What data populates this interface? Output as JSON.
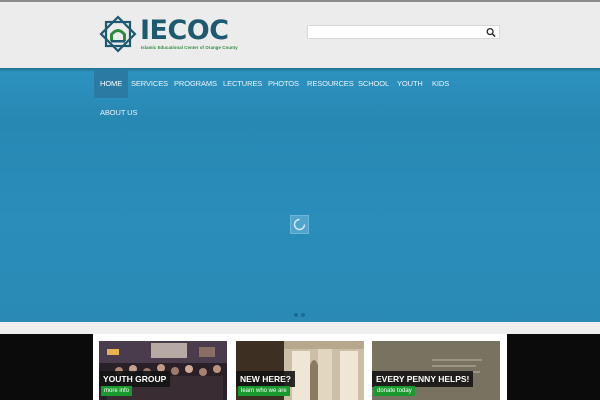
{
  "brand": {
    "name": "IECOC",
    "tagline": "Islamic Educational Center of Orange County",
    "colors": {
      "primary": "#1d5a6f",
      "accent": "#2c8a3b",
      "hero": "#2a8ab5"
    }
  },
  "search": {
    "placeholder": "",
    "button_icon": "magnifier-icon"
  },
  "nav": {
    "items": [
      {
        "label": "HOME",
        "active": true
      },
      {
        "label": "SERVICES"
      },
      {
        "label": "PROGRAMS"
      },
      {
        "label": "LECTURES"
      },
      {
        "label": "PHOTOS"
      },
      {
        "label": "RESOURCES"
      },
      {
        "label": "SCHOOL"
      },
      {
        "label": "YOUTH"
      },
      {
        "label": "KIDS"
      },
      {
        "label": "ABOUT US"
      }
    ]
  },
  "slider": {
    "loading_icon": "spinner-icon",
    "slide_count": 2
  },
  "cards": [
    {
      "title": "YOUTH GROUP",
      "button": "more info"
    },
    {
      "title": "NEW HERE?",
      "button": "learn who we are"
    },
    {
      "title": "EVERY PENNY HELPS!",
      "button": "donate today"
    }
  ]
}
